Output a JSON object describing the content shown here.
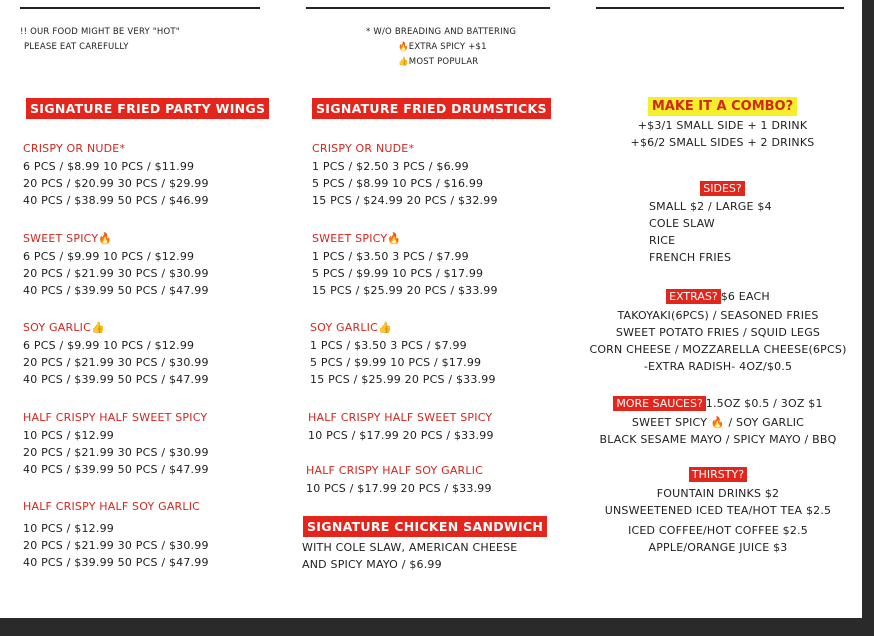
{
  "notes": {
    "left": [
      "!! OUR FOOD MIGHT BE VERY \"HOT\"",
      "PLEASE EAT CAREFULLY"
    ],
    "mid_1": "* W/O BREADING AND BATTERING",
    "mid_2": "🔥EXTRA SPICY +$1",
    "mid_3": "👍MOST POPULAR"
  },
  "wings": {
    "title": "SIGNATURE FRIED PARTY WINGS",
    "sections": [
      {
        "header": "CRISPY OR NUDE*",
        "lines": [
          "6 PCS  /  $8.99   10 PCS  /  $11.99",
          "20 PCS  /  $20.99   30 PCS  /  $29.99",
          "40 PCS  /  $38.99   50 PCS  /  $46.99"
        ]
      },
      {
        "header": "SWEET SPICY🔥",
        "lines": [
          "6 PCS  /  $9.99   10 PCS  /  $12.99",
          "20 PCS  /  $21.99  30 PCS  /  $30.99",
          "40 PCS  /  $39.99  50 PCS  /  $47.99"
        ]
      },
      {
        "header": "SOY GARLIC👍",
        "lines": [
          "6 PCS  /  $9.99   10 PCS  /  $12.99",
          "20 PCS  /  $21.99  30 PCS  /  $30.99",
          "40 PCS  /  $39.99  50 PCS  /  $47.99"
        ]
      },
      {
        "header": "HALF CRISPY HALF SWEET SPICY",
        "lines": [
          "10 PCS  /  $12.99",
          "20 PCS  /  $21.99  30 PCS  /  $30.99",
          "40 PCS  /  $39.99  50 PCS  /  $47.99"
        ]
      },
      {
        "header": "HALF CRISPY HALF SOY GARLIC",
        "lines": [
          "10 PCS  /  $12.99",
          "20 PCS  /  $21.99  30 PCS  /  $30.99",
          "40 PCS  /  $39.99  50 PCS  /  $47.99"
        ]
      }
    ]
  },
  "drumsticks": {
    "title": "SIGNATURE FRIED DRUMSTICKS",
    "sections": [
      {
        "header": "CRISPY OR NUDE*",
        "lines": [
          "1 PCS  /  $2.50    3 PCS  /  $6.99",
          "5 PCS  /  $8.99    10 PCS  /  $16.99",
          "15 PCS  /  $24.99   20 PCS  /  $32.99"
        ]
      },
      {
        "header": "SWEET SPICY🔥",
        "lines": [
          "1 PCS  /  $3.50    3 PCS  /  $7.99",
          "5 PCS  /  $9.99    10 PCS  /  $17.99",
          "15 PCS  /  $25.99   20 PCS  /  $33.99"
        ]
      },
      {
        "header": "SOY GARLIC👍",
        "lines": [
          "1 PCS  /  $3.50    3 PCS  /  $7.99",
          "5 PCS  /  $9.99    10 PCS  /  $17.99",
          "15 PCS  /  $25.99   20 PCS  /  $33.99"
        ]
      },
      {
        "header": "HALF CRISPY HALF SWEET SPICY",
        "lines": [
          "10 PCS  /  $17.99     20 PCS  /  $33.99"
        ]
      },
      {
        "header": "HALF CRISPY HALF SOY GARLIC",
        "lines": [
          "10 PCS  /  $17.99     20 PCS  /  $33.99"
        ]
      }
    ],
    "sandwich_title": "SIGNATURE CHICKEN SANDWICH",
    "sandwich_lines": [
      "WITH COLE SLAW, AMERICAN CHEESE",
      "AND SPICY MAYO / $6.99"
    ]
  },
  "combo": {
    "title": "MAKE IT A COMBO?",
    "lines": [
      "+$3/1 SMALL SIDE + 1 DRINK",
      "+$6/2 SMALL SIDES + 2  DRINKS"
    ]
  },
  "sides": {
    "title": "SIDES?",
    "lines": [
      "SMALL $2 / LARGE $4",
      "COLE SLAW",
      "RICE",
      "FRENCH FRIES"
    ]
  },
  "extras": {
    "title": "EXTRAS?",
    "title_suffix": "$6 EACH",
    "lines": [
      "TAKOYAKI(6PCS) / SEASONED FRIES",
      "SWEET POTATO FRIES / SQUID LEGS",
      "CORN CHEESE / MOZZARELLA CHEESE(6PCS)",
      "-EXTRA RADISH- 4OZ/$0.5"
    ]
  },
  "sauces": {
    "title": "MORE SAUCES?",
    "title_suffix": "1.5OZ $0.5 / 3OZ $1",
    "lines": [
      "SWEET SPICY 🔥 / SOY GARLIC",
      "BLACK SESAME MAYO / SPICY MAYO / BBQ"
    ]
  },
  "thirsty": {
    "title": "THIRSTY?",
    "lines": [
      "FOUNTAIN DRINKS $2",
      "UNSWEETENED ICED TEA/HOT TEA $2.5",
      "ICED COFFEE/HOT COFFEE $2.5",
      "APPLE/ORANGE JUICE $3"
    ]
  }
}
